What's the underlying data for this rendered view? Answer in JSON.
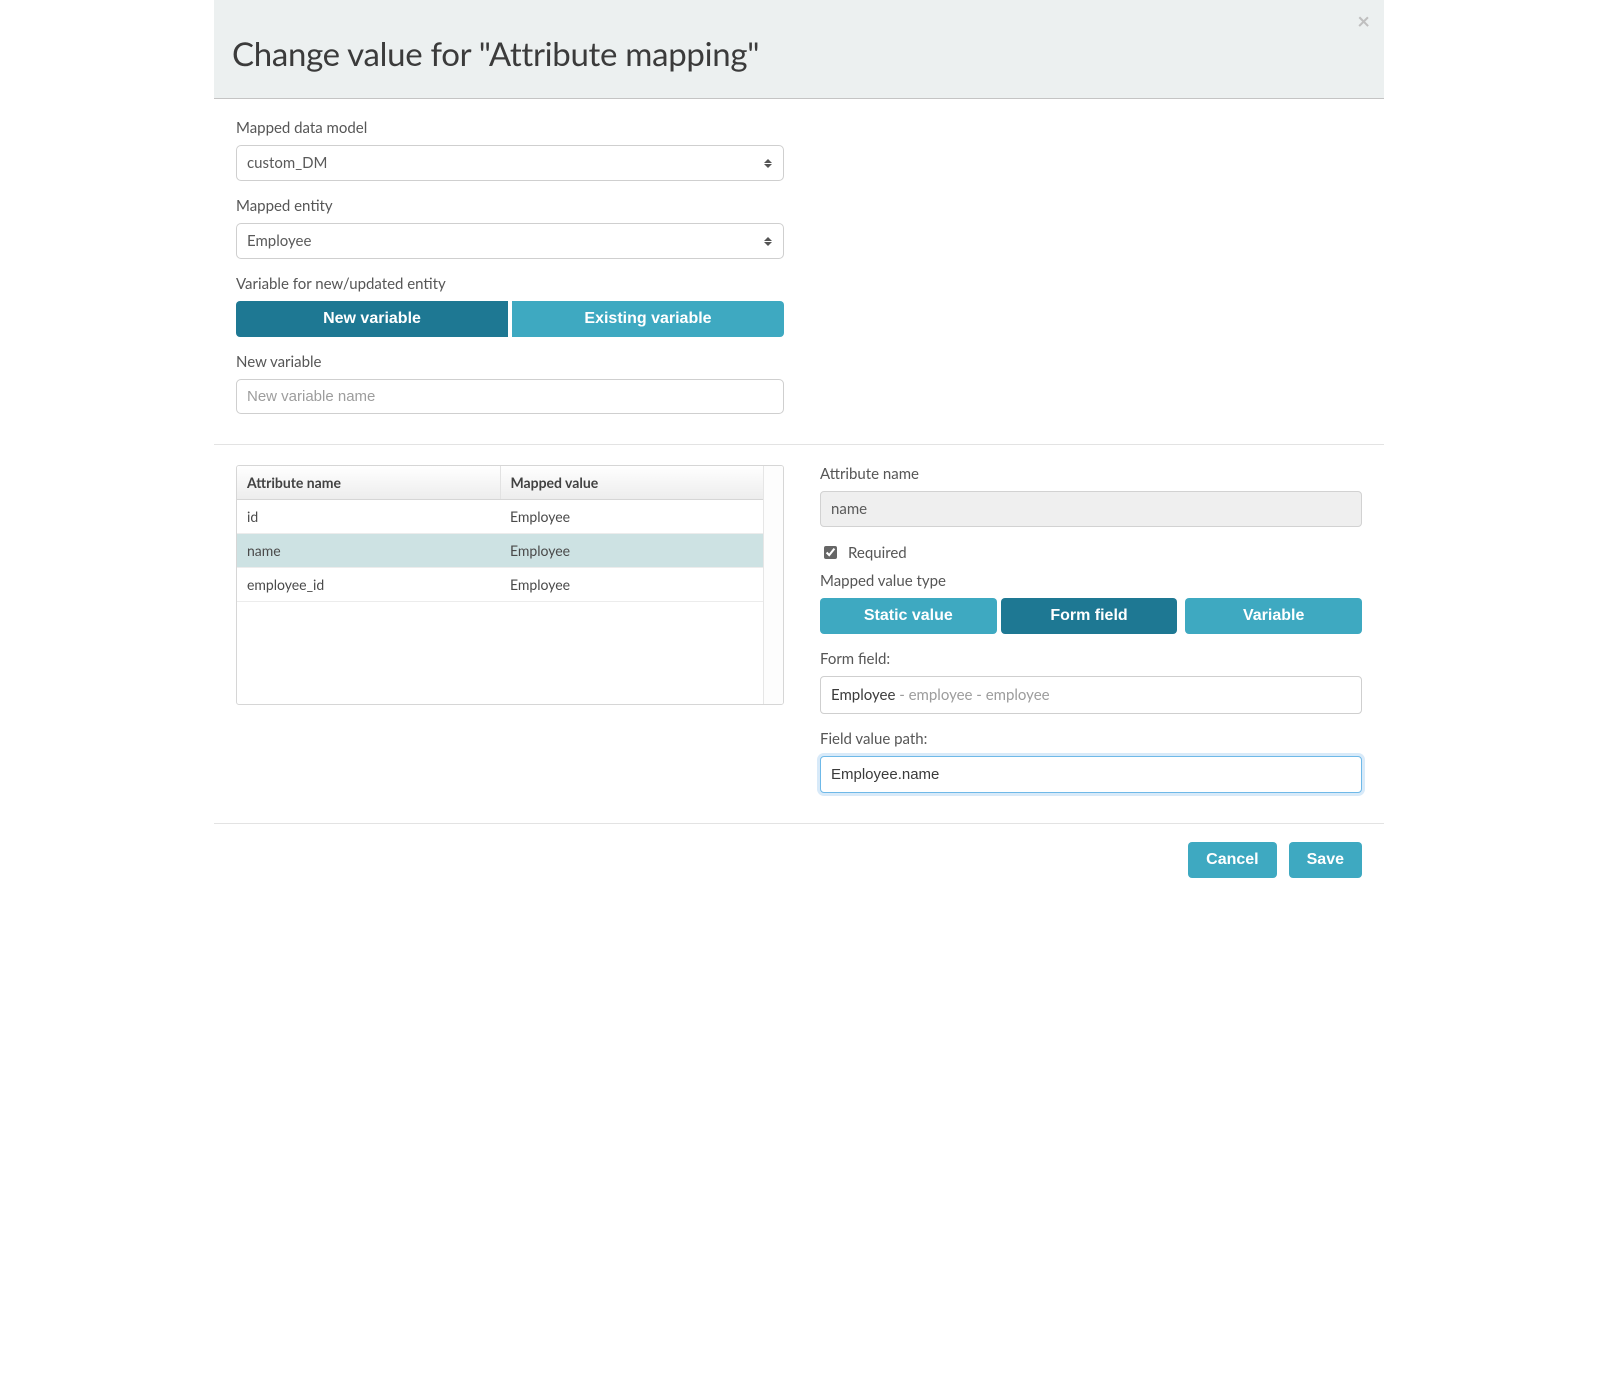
{
  "header": {
    "title": "Change value for \"Attribute mapping\""
  },
  "form": {
    "mapped_data_model": {
      "label": "Mapped data model",
      "value": "custom_DM"
    },
    "mapped_entity": {
      "label": "Mapped entity",
      "value": "Employee"
    },
    "variable_mode": {
      "label": "Variable for new/updated entity",
      "options": {
        "new": "New variable",
        "existing": "Existing variable"
      },
      "selected": "new"
    },
    "new_variable": {
      "label": "New variable",
      "placeholder": "New variable name",
      "value": ""
    }
  },
  "table": {
    "headers": {
      "attr": "Attribute name",
      "mv": "Mapped value"
    },
    "rows": [
      {
        "attr": "id",
        "mv": "Employee",
        "selected": false
      },
      {
        "attr": "name",
        "mv": "Employee",
        "selected": true
      },
      {
        "attr": "employee_id",
        "mv": "Employee",
        "selected": false
      }
    ]
  },
  "right": {
    "attr_name": {
      "label": "Attribute name",
      "value": "name"
    },
    "required": {
      "label": "Required",
      "checked": true
    },
    "mapped_value_type": {
      "label": "Mapped value type",
      "options": {
        "static": "Static value",
        "form": "Form field",
        "variable": "Variable"
      },
      "selected": "form"
    },
    "form_field": {
      "label": "Form field:",
      "primary": "Employee",
      "secondary": " - employee - employee"
    },
    "field_value_path": {
      "label": "Field value path:",
      "value": "Employee.name"
    }
  },
  "footer": {
    "cancel": "Cancel",
    "save": "Save"
  }
}
